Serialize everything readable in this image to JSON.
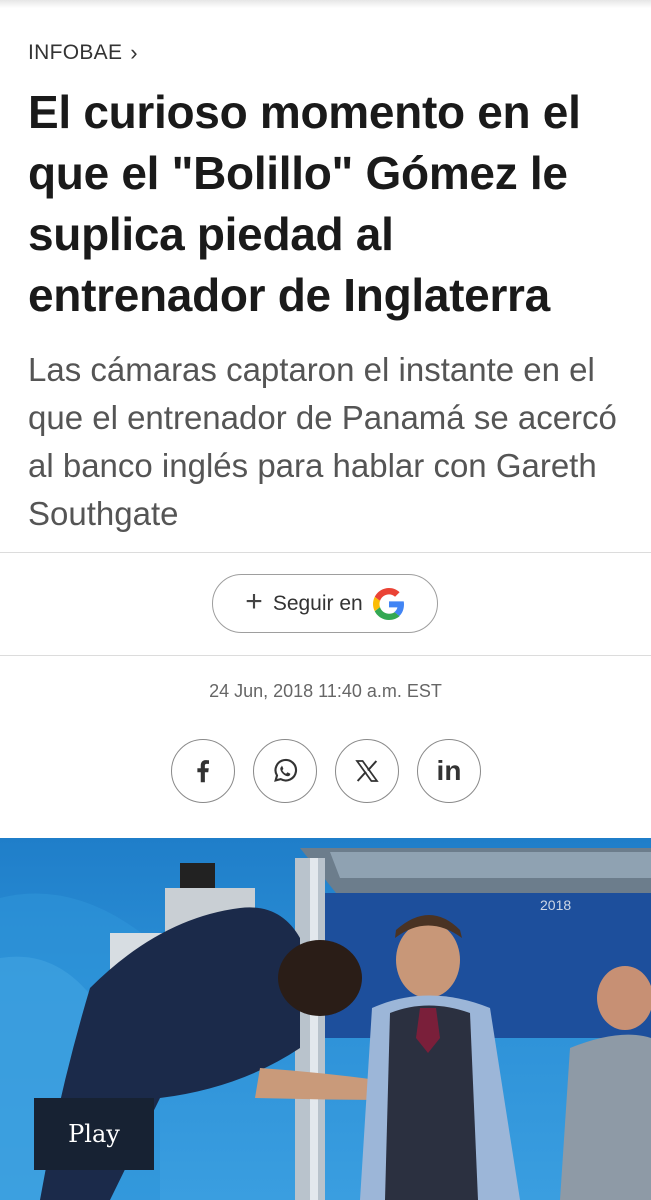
{
  "header": {
    "kicker": "INFOBAE",
    "kicker_chevron": "›"
  },
  "article": {
    "headline": "El curioso momento en el que el \"Bolillo\" Gómez le suplica piedad al entrenador de Inglaterra",
    "subhead": "Las cámaras captaron el instante en el que el entrenador de Panamá se acercó al banco inglés para hablar con Gareth Southgate",
    "date": "24 Jun, 2018 11:40 a.m. EST"
  },
  "follow": {
    "plus": "+",
    "label": "Seguir en",
    "icon": "google-logo-icon"
  },
  "share": [
    {
      "name": "facebook-icon",
      "glyph": "f"
    },
    {
      "name": "whatsapp-icon"
    },
    {
      "name": "x-icon"
    },
    {
      "name": "linkedin-icon",
      "glyph": "in"
    }
  ],
  "video": {
    "play_label": "Play",
    "overlay_text": "2018"
  },
  "colors": {
    "text": "#1a1a1a",
    "muted": "#555555",
    "play_bg": "#172233",
    "video_bg": "#2b8fd6"
  }
}
